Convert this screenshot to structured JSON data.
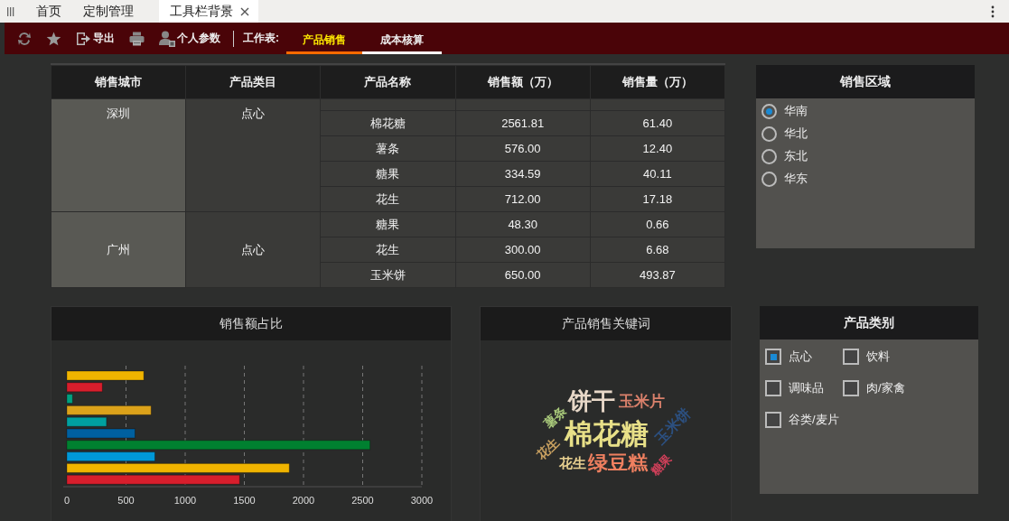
{
  "tabs": [
    {
      "label": "首页",
      "selected": false,
      "closable": false
    },
    {
      "label": "定制管理",
      "selected": false,
      "closable": false
    },
    {
      "label": "工具栏背景",
      "selected": true,
      "closable": true
    }
  ],
  "toolbar": {
    "buttons": [
      {
        "kind": "refresh"
      },
      {
        "kind": "star"
      },
      {
        "kind": "export",
        "label": "导出"
      },
      {
        "kind": "print"
      },
      {
        "kind": "params",
        "label": "个人参数"
      }
    ],
    "sheet_label": "工作表:",
    "sheets": [
      {
        "label": "产品销售",
        "selected": true
      },
      {
        "label": "成本核算",
        "selected": false
      }
    ]
  },
  "table": {
    "columns": [
      "销售城市",
      "产品类目",
      "产品名称",
      "销售额（万）",
      "销售量（万）"
    ],
    "groups": [
      {
        "city": "深圳",
        "category": "点心",
        "rows": [
          [
            "棉花糖",
            "2561.81",
            "61.40"
          ],
          [
            "薯条",
            "576.00",
            "12.40"
          ],
          [
            "糖果",
            "334.59",
            "40.11"
          ],
          [
            "花生",
            "712.00",
            "17.18"
          ]
        ]
      },
      {
        "city": "广州",
        "category": "点心",
        "rows": [
          [
            "糖果",
            "48.30",
            "0.66"
          ],
          [
            "花生",
            "300.00",
            "6.68"
          ],
          [
            "玉米饼",
            "650.00",
            "493.87"
          ]
        ]
      }
    ]
  },
  "region_panel": {
    "title": "销售区域",
    "options": [
      {
        "label": "华南",
        "selected": true
      },
      {
        "label": "华北",
        "selected": false
      },
      {
        "label": "东北",
        "selected": false
      },
      {
        "label": "华东",
        "selected": false
      }
    ]
  },
  "bar_panel": {
    "title": "销售额占比",
    "chart_data": {
      "type": "bar",
      "orientation": "horizontal",
      "xlim": [
        0,
        3000
      ],
      "xticks": [
        0,
        500,
        1000,
        1500,
        2000,
        2500,
        3000
      ],
      "grid": true,
      "series": [
        {
          "values": [
            650,
            300,
            48,
            712,
            335,
            576,
            2562,
            744,
            1880,
            1460
          ]
        }
      ],
      "colors": [
        "#f0b400",
        "#d81e2c",
        "#00a080",
        "#dca21a",
        "#00a0a0",
        "#0060a0",
        "#008030",
        "#0098d8",
        "#f0b400",
        "#d81e2c"
      ]
    }
  },
  "wordcloud_panel": {
    "title": "产品销售关键词",
    "words": [
      {
        "text": "饼干",
        "color": "#e8d8c8"
      },
      {
        "text": "玉米片",
        "color": "#d9806b"
      },
      {
        "text": "薯条",
        "color": "#a8c87a"
      },
      {
        "text": "棉花糖",
        "color": "#e8e088"
      },
      {
        "text": "玉米饼",
        "color": "#2c5080"
      },
      {
        "text": "花生",
        "color": "#c8a060"
      },
      {
        "text": "花生",
        "color": "#e8d090"
      },
      {
        "text": "绿豆糕",
        "color": "#f08060"
      },
      {
        "text": "糖果",
        "color": "#d0405a"
      }
    ]
  },
  "category_panel": {
    "title": "产品类别",
    "options": [
      {
        "label": "点心",
        "checked": true
      },
      {
        "label": "饮料",
        "checked": false
      },
      {
        "label": "调味品",
        "checked": false
      },
      {
        "label": "肉/家禽",
        "checked": false
      },
      {
        "label": "谷类/麦片",
        "checked": false
      }
    ]
  }
}
